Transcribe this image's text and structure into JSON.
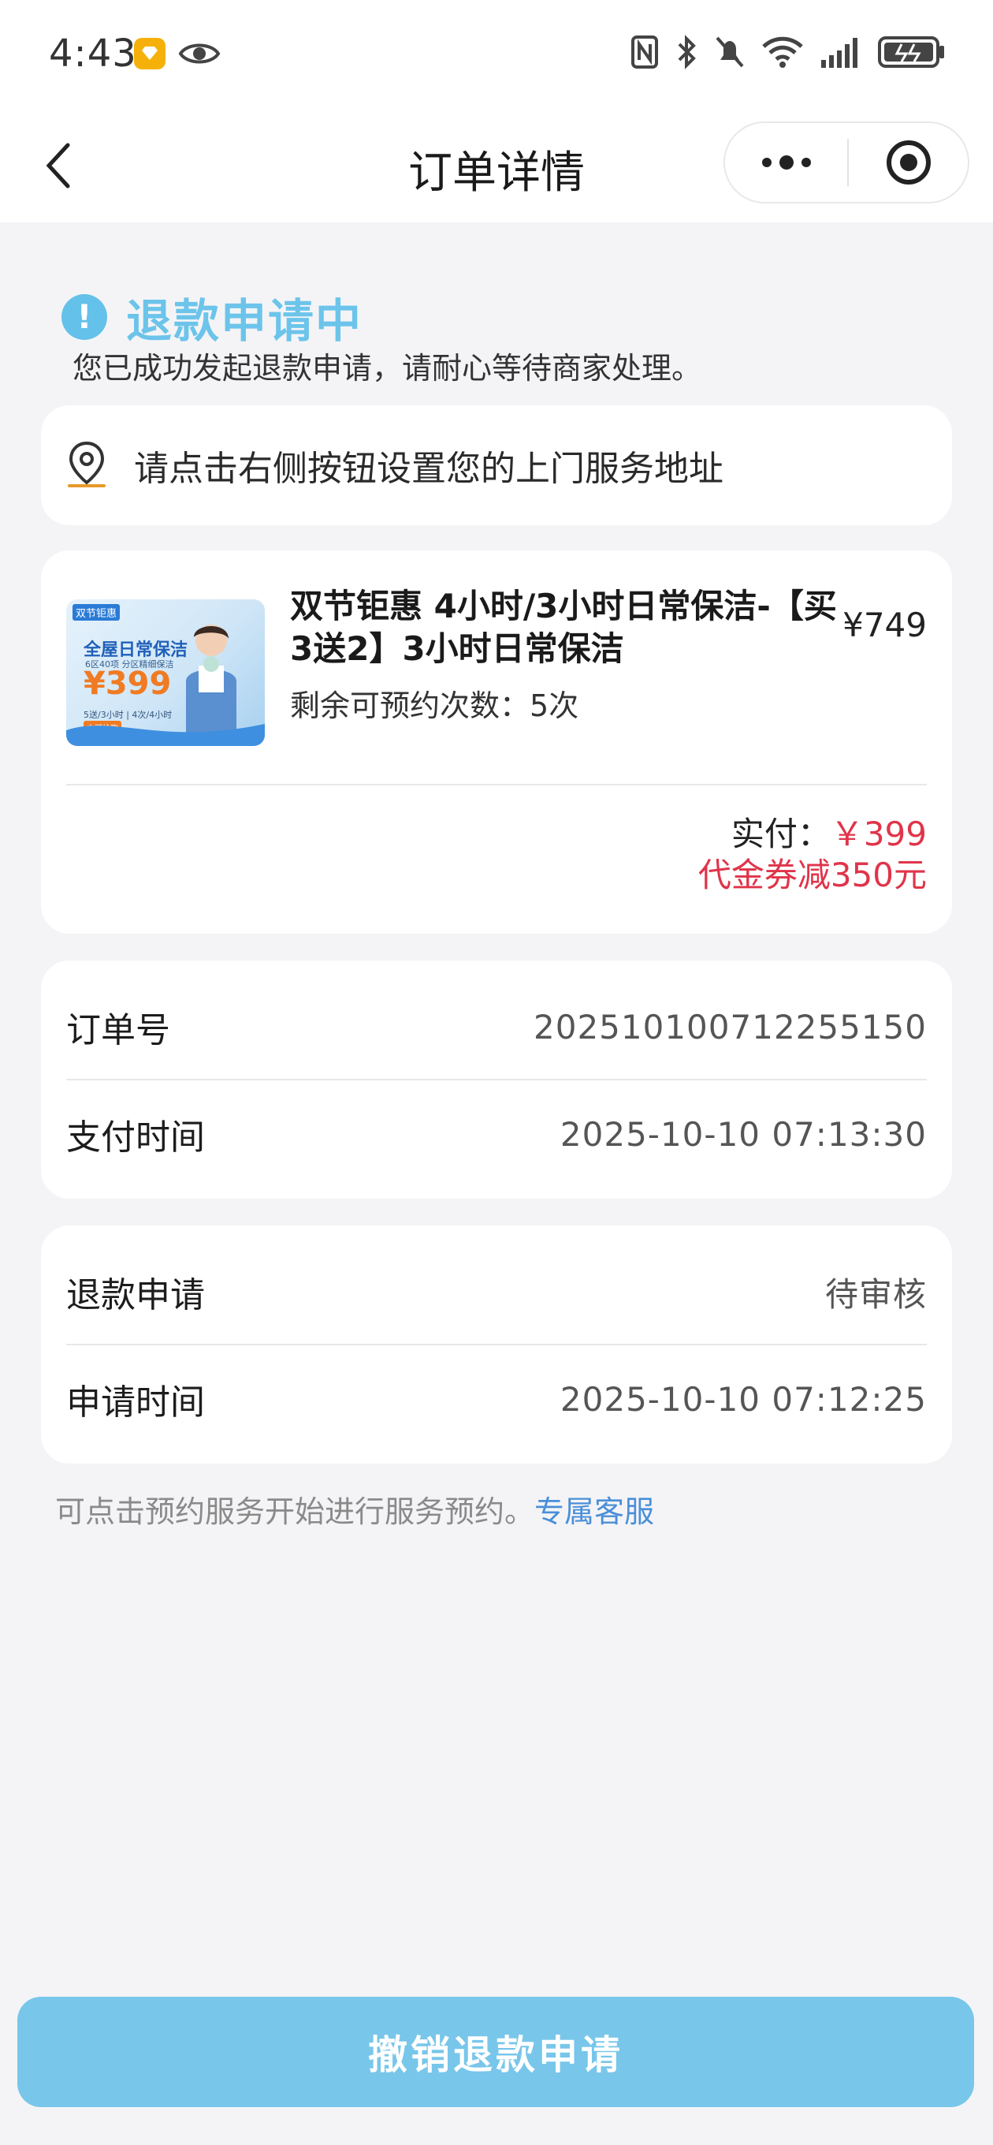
{
  "status_bar": {
    "time": "4:43"
  },
  "nav": {
    "title": "订单详情"
  },
  "refund_status": {
    "title": "退款申请中",
    "description": "您已成功发起退款申请，请耐心等待商家处理。"
  },
  "address": {
    "prompt": "请点击右侧按钮设置您的上门服务地址"
  },
  "product": {
    "thumbnail": {
      "tag": "双节钜惠",
      "headline": "全屋日常保洁",
      "subline": "6区40项 分区精细保洁",
      "price": "¥399",
      "options": "5送/3小时 | 4次/4小时",
      "badge": "立即抢购"
    },
    "title": "双节钜惠 4小时/3小时日常保洁-【买3送2】3小时日常保洁",
    "price": "¥749",
    "remaining_label": "剩余可预约次数：",
    "remaining_value": "5次",
    "paid_label": "实付：",
    "paid_value": "￥399",
    "coupon": "代金券减350元"
  },
  "order_info": {
    "order_no_label": "订单号",
    "order_no": "202510100712255150",
    "pay_time_label": "支付时间",
    "pay_time": "2025-10-10 07:13:30"
  },
  "refund_info": {
    "refund_label": "退款申请",
    "refund_status": "待审核",
    "apply_time_label": "申请时间",
    "apply_time": "2025-10-10 07:12:25"
  },
  "footer": {
    "note": "可点击预约服务开始进行服务预约。",
    "link": "专属客服"
  },
  "actions": {
    "cancel_refund": "撤销退款申请"
  },
  "colors": {
    "accent_blue": "#6cc4ea",
    "button_blue": "#78c6ea",
    "price_red": "#e0344a",
    "link_blue": "#4a8fd8"
  }
}
